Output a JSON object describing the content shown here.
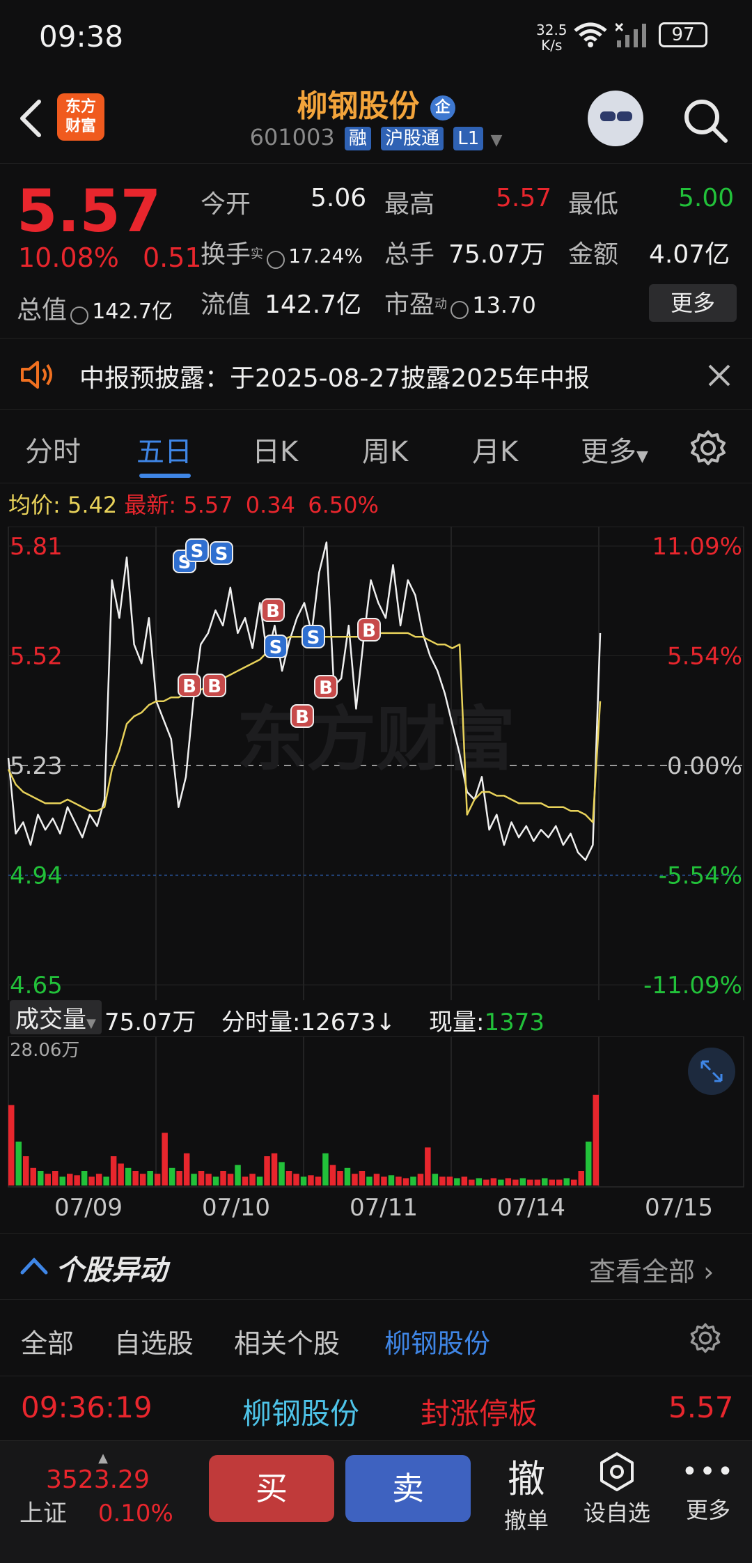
{
  "status": {
    "time": "09:38",
    "net_speed": "32.5",
    "net_unit": "K/s",
    "battery": "97"
  },
  "header": {
    "logo_line1": "东方",
    "logo_line2": "财富",
    "title": "柳钢股份",
    "badge": "企",
    "code": "601003",
    "chip1": "融",
    "chip2": "沪股通",
    "chip3": "L1"
  },
  "quote": {
    "price": "5.57",
    "change_pct": "10.08%",
    "change": "0.51",
    "open_label": "今开",
    "open": "5.06",
    "high_label": "最高",
    "high": "5.57",
    "low_label": "最低",
    "low": "5.00",
    "turnover_label": "换手",
    "turnover_sup": "实",
    "turnover": "17.24%",
    "volume_label": "总手",
    "volume": "75.07万",
    "amount_label": "金额",
    "amount": "4.07亿",
    "mktcap_label": "总值",
    "mktcap": "142.7亿",
    "float_label": "流值",
    "float": "142.7亿",
    "pe_label": "市盈",
    "pe_sup": "动",
    "pe": "13.70",
    "more": "更多"
  },
  "notice": {
    "text": "中报预披露：于2025-08-27披露2025年中报"
  },
  "tabs": [
    "分时",
    "五日",
    "日K",
    "周K",
    "月K",
    "更多"
  ],
  "active_tab": "五日",
  "avg_bar": {
    "avg_label": "均价:",
    "avg": "5.42",
    "latest_label": "最新:",
    "latest": "5.57",
    "chg": "0.34",
    "pct": "6.50%"
  },
  "chart_data": {
    "type": "line",
    "y_labels_left": [
      "5.81",
      "5.52",
      "5.23",
      "4.94",
      "4.65"
    ],
    "y_labels_right": [
      "11.09%",
      "5.54%",
      "0.00%",
      "-5.54%",
      "-11.09%"
    ],
    "ylim": [
      4.65,
      5.81
    ],
    "x_labels": [
      "07/09",
      "07/10",
      "07/11",
      "07/14",
      "07/15"
    ],
    "watermark": "东方财富",
    "series": [
      {
        "values": [
          5.25,
          5.05,
          5.08,
          5.02,
          5.1,
          5.06,
          5.09,
          5.05,
          5.12,
          5.08,
          5.04,
          5.1,
          5.07,
          5.14,
          5.72,
          5.62,
          5.78,
          5.55,
          5.5,
          5.62,
          5.4,
          5.35,
          5.3,
          5.12,
          5.2,
          5.4,
          5.55,
          5.58,
          5.64,
          5.6,
          5.7,
          5.58,
          5.62,
          5.54,
          5.66,
          5.52,
          5.6,
          5.48,
          5.56,
          5.62,
          5.66,
          5.58,
          5.74,
          5.82,
          5.44,
          5.46,
          5.6,
          5.38,
          5.56,
          5.72,
          5.66,
          5.62,
          5.76,
          5.6,
          5.72,
          5.68,
          5.58,
          5.52,
          5.48,
          5.42,
          5.34,
          5.26,
          5.16,
          5.14,
          5.2,
          5.06,
          5.1,
          5.02,
          5.08,
          5.04,
          5.07,
          5.03,
          5.06,
          5.04,
          5.07,
          5.02,
          5.05,
          5.0,
          4.98,
          5.02,
          5.58
        ]
      },
      {
        "values": [
          5.22,
          5.18,
          5.16,
          5.15,
          5.14,
          5.13,
          5.13,
          5.13,
          5.14,
          5.13,
          5.12,
          5.11,
          5.11,
          5.12,
          5.22,
          5.27,
          5.34,
          5.36,
          5.37,
          5.39,
          5.4,
          5.4,
          5.41,
          5.41,
          5.42,
          5.42,
          5.43,
          5.44,
          5.45,
          5.46,
          5.47,
          5.48,
          5.49,
          5.5,
          5.51,
          5.53,
          5.55,
          5.56,
          5.57,
          5.57,
          5.57,
          5.57,
          5.57,
          5.57,
          5.57,
          5.57,
          5.57,
          5.57,
          5.57,
          5.58,
          5.58,
          5.58,
          5.58,
          5.58,
          5.58,
          5.57,
          5.57,
          5.56,
          5.55,
          5.55,
          5.54,
          5.55,
          5.1,
          5.14,
          5.16,
          5.16,
          5.15,
          5.15,
          5.14,
          5.13,
          5.13,
          5.13,
          5.13,
          5.12,
          5.12,
          5.12,
          5.11,
          5.11,
          5.1,
          5.08,
          5.4
        ]
      }
    ]
  },
  "trade_marks": [
    {
      "type": "S",
      "label": "S"
    },
    {
      "type": "S",
      "label": "S"
    },
    {
      "type": "S",
      "label": "S"
    },
    {
      "type": "B",
      "label": "B"
    },
    {
      "type": "B",
      "label": "B"
    },
    {
      "type": "B",
      "label": "B"
    },
    {
      "type": "S",
      "label": "S"
    },
    {
      "type": "S",
      "label": "S"
    },
    {
      "type": "B",
      "label": "B"
    },
    {
      "type": "B",
      "label": "B"
    },
    {
      "type": "B",
      "label": "B"
    }
  ],
  "volume": {
    "selector": "成交量",
    "total": "75.07万",
    "tick_label": "分时量:",
    "tick": "12673",
    "tick_arrow": "↓",
    "now_label": "现量:",
    "now": "1373",
    "max_label": "28.06万",
    "bars": [
      0.55,
      0.3,
      0.2,
      0.12,
      0.1,
      0.08,
      0.1,
      0.06,
      0.08,
      0.07,
      0.1,
      0.06,
      0.08,
      0.06,
      0.2,
      0.15,
      0.12,
      0.1,
      0.08,
      0.1,
      0.08,
      0.36,
      0.12,
      0.1,
      0.22,
      0.08,
      0.1,
      0.08,
      0.06,
      0.1,
      0.08,
      0.14,
      0.06,
      0.08,
      0.06,
      0.2,
      0.22,
      0.16,
      0.1,
      0.08,
      0.06,
      0.07,
      0.06,
      0.22,
      0.14,
      0.1,
      0.12,
      0.08,
      0.1,
      0.06,
      0.08,
      0.06,
      0.07,
      0.06,
      0.05,
      0.06,
      0.08,
      0.26,
      0.08,
      0.06,
      0.06,
      0.05,
      0.06,
      0.04,
      0.05,
      0.04,
      0.05,
      0.04,
      0.05,
      0.04,
      0.05,
      0.04,
      0.04,
      0.05,
      0.04,
      0.04,
      0.05,
      0.04,
      0.1,
      0.3,
      0.62
    ]
  },
  "movement": {
    "title": "个股异动",
    "view_all": "查看全部",
    "tabs": [
      "全部",
      "自选股",
      "相关个股",
      "柳钢股份"
    ],
    "row": {
      "time": "09:36:19",
      "name": "柳钢股份",
      "event": "封涨停板",
      "price": "5.57"
    }
  },
  "bottom": {
    "index_value": "3523.29",
    "index_name": "上证",
    "index_pct": "0.10%",
    "buy": "买",
    "sell": "卖",
    "cancel_icon": "撤",
    "cancel": "撤单",
    "watch": "设自选",
    "more": "更多"
  },
  "colors": {
    "up": "#e8262d",
    "down": "#22c13a",
    "accent": "#3f86e6",
    "avg": "#e8d25a"
  }
}
